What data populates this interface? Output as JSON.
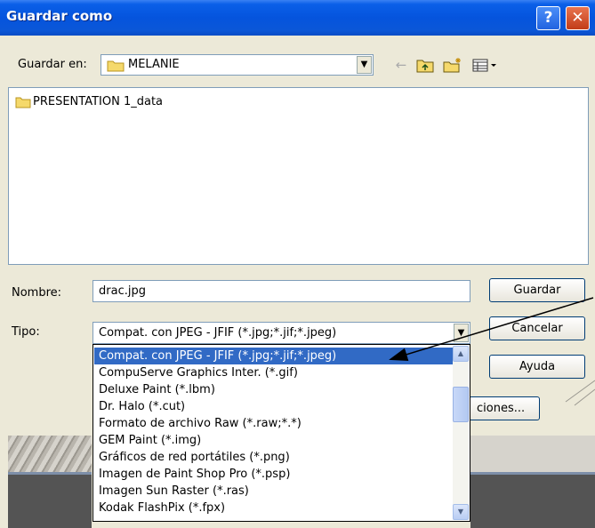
{
  "window": {
    "title": "Guardar como",
    "help_label": "?",
    "close_label": "✕"
  },
  "toolbar": {
    "save_in_label": "Guardar en:",
    "save_in_value": "MELANIE",
    "icons": [
      "back-icon",
      "up-folder-icon",
      "new-folder-icon",
      "view-menu-icon"
    ]
  },
  "file_list": {
    "items": [
      {
        "name": "PRESENTATION 1_data",
        "icon": "folder-icon"
      }
    ]
  },
  "form": {
    "name_label": "Nombre:",
    "name_value": "drac.jpg",
    "type_label": "Tipo:",
    "type_value": "Compat. con JPEG - JFIF (*.jpg;*.jif;*.jpeg)"
  },
  "buttons": {
    "save": "Guardar",
    "cancel": "Cancelar",
    "help": "Ayuda",
    "options_partial": "ciones..."
  },
  "type_dropdown": {
    "selected_index": 0,
    "options": [
      "Compat. con JPEG - JFIF (*.jpg;*.jif;*.jpeg)",
      "CompuServe Graphics Inter. (*.gif)",
      "Deluxe Paint (*.lbm)",
      "Dr. Halo (*.cut)",
      "Formato de archivo Raw (*.raw;*.*)",
      "GEM Paint (*.img)",
      "Gráficos de red portátiles (*.png)",
      "Imagen de Paint Shop Pro (*.psp)",
      "Imagen Sun Raster (*.ras)",
      "Kodak FlashPix (*.fpx)"
    ]
  },
  "colors": {
    "titlebar": "#0554dd",
    "selection": "#316ac5",
    "dialog_bg": "#ece9d8"
  }
}
